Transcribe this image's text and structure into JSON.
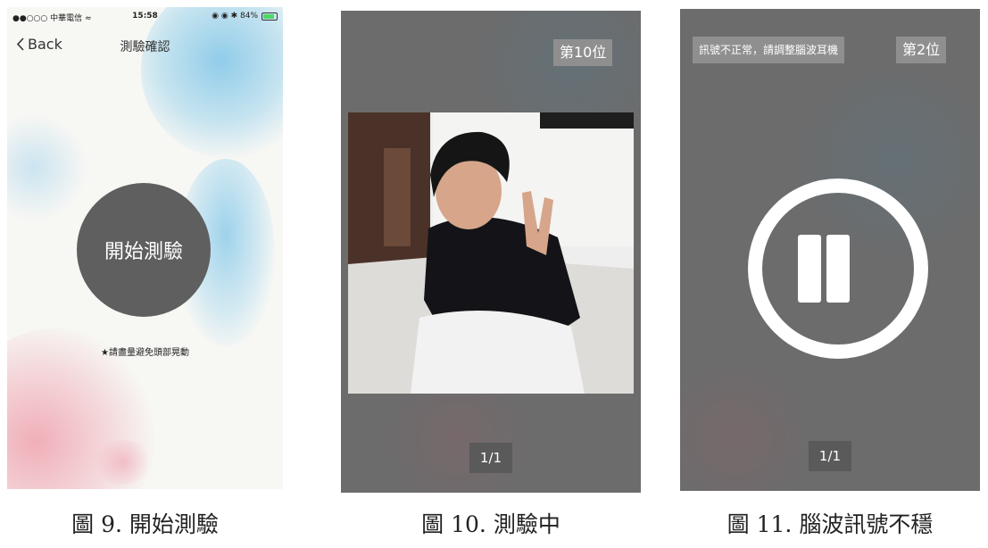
{
  "screen1": {
    "status": {
      "carrier": "●●○○○ 中華電信 ≈",
      "time": "15:58",
      "indicators": "◉ ◉ ✱ 84%",
      "battery_level": 0.84
    },
    "nav": {
      "back_label": "Back",
      "title": "測驗確認"
    },
    "start_button_label": "開始測驗",
    "hint": "★請盡量避免頭部晃動"
  },
  "screen2": {
    "rank_tag": "第10位",
    "counter": "1/1"
  },
  "screen3": {
    "warning_tag": "訊號不正常，請調整腦波耳機",
    "rank_tag": "第2位",
    "counter": "1/1"
  },
  "captions": [
    "圖 9. 開始測驗",
    "圖 10. 測驗中",
    "圖 11. 腦波訊號不穩"
  ],
  "colors": {
    "button_dark": "#5f5f5f",
    "overlay_gray": "#6c6c6c",
    "tag_gray": "#8f8f8f"
  }
}
